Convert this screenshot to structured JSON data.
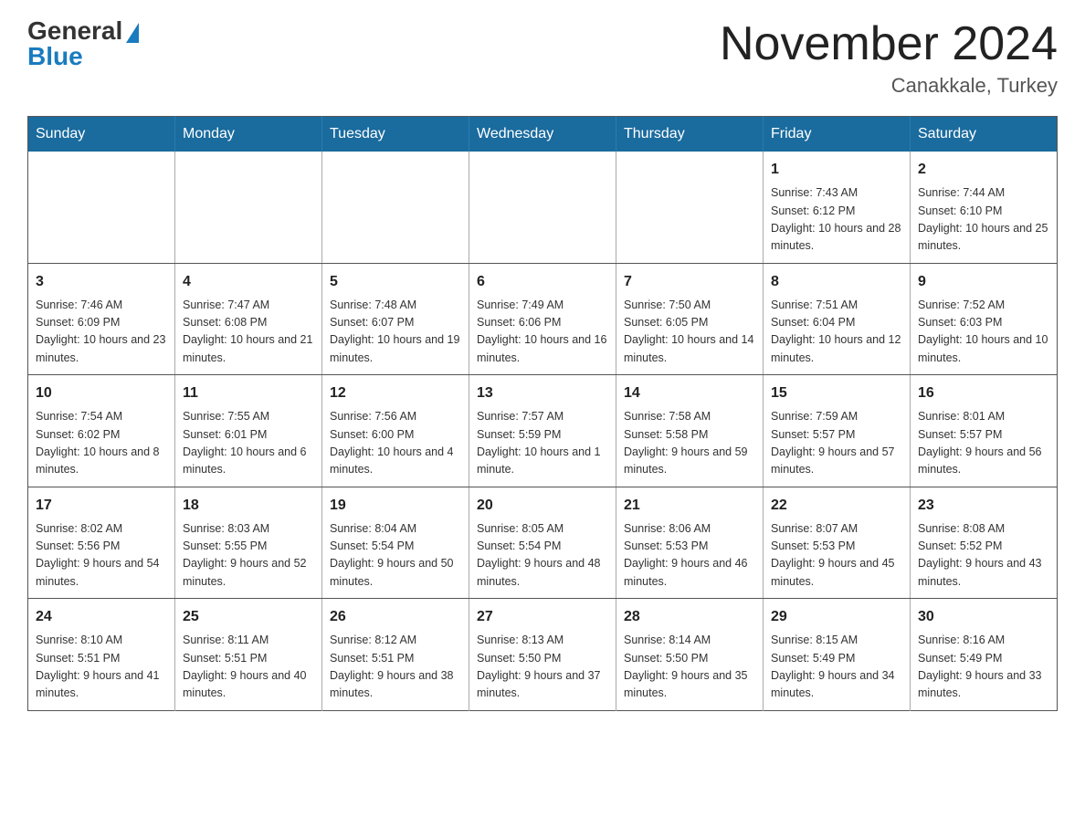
{
  "header": {
    "logo_general": "General",
    "logo_blue": "Blue",
    "title": "November 2024",
    "subtitle": "Canakkale, Turkey"
  },
  "weekdays": [
    "Sunday",
    "Monday",
    "Tuesday",
    "Wednesday",
    "Thursday",
    "Friday",
    "Saturday"
  ],
  "weeks": [
    [
      {
        "day": "",
        "info": ""
      },
      {
        "day": "",
        "info": ""
      },
      {
        "day": "",
        "info": ""
      },
      {
        "day": "",
        "info": ""
      },
      {
        "day": "",
        "info": ""
      },
      {
        "day": "1",
        "info": "Sunrise: 7:43 AM\nSunset: 6:12 PM\nDaylight: 10 hours and 28 minutes."
      },
      {
        "day": "2",
        "info": "Sunrise: 7:44 AM\nSunset: 6:10 PM\nDaylight: 10 hours and 25 minutes."
      }
    ],
    [
      {
        "day": "3",
        "info": "Sunrise: 7:46 AM\nSunset: 6:09 PM\nDaylight: 10 hours and 23 minutes."
      },
      {
        "day": "4",
        "info": "Sunrise: 7:47 AM\nSunset: 6:08 PM\nDaylight: 10 hours and 21 minutes."
      },
      {
        "day": "5",
        "info": "Sunrise: 7:48 AM\nSunset: 6:07 PM\nDaylight: 10 hours and 19 minutes."
      },
      {
        "day": "6",
        "info": "Sunrise: 7:49 AM\nSunset: 6:06 PM\nDaylight: 10 hours and 16 minutes."
      },
      {
        "day": "7",
        "info": "Sunrise: 7:50 AM\nSunset: 6:05 PM\nDaylight: 10 hours and 14 minutes."
      },
      {
        "day": "8",
        "info": "Sunrise: 7:51 AM\nSunset: 6:04 PM\nDaylight: 10 hours and 12 minutes."
      },
      {
        "day": "9",
        "info": "Sunrise: 7:52 AM\nSunset: 6:03 PM\nDaylight: 10 hours and 10 minutes."
      }
    ],
    [
      {
        "day": "10",
        "info": "Sunrise: 7:54 AM\nSunset: 6:02 PM\nDaylight: 10 hours and 8 minutes."
      },
      {
        "day": "11",
        "info": "Sunrise: 7:55 AM\nSunset: 6:01 PM\nDaylight: 10 hours and 6 minutes."
      },
      {
        "day": "12",
        "info": "Sunrise: 7:56 AM\nSunset: 6:00 PM\nDaylight: 10 hours and 4 minutes."
      },
      {
        "day": "13",
        "info": "Sunrise: 7:57 AM\nSunset: 5:59 PM\nDaylight: 10 hours and 1 minute."
      },
      {
        "day": "14",
        "info": "Sunrise: 7:58 AM\nSunset: 5:58 PM\nDaylight: 9 hours and 59 minutes."
      },
      {
        "day": "15",
        "info": "Sunrise: 7:59 AM\nSunset: 5:57 PM\nDaylight: 9 hours and 57 minutes."
      },
      {
        "day": "16",
        "info": "Sunrise: 8:01 AM\nSunset: 5:57 PM\nDaylight: 9 hours and 56 minutes."
      }
    ],
    [
      {
        "day": "17",
        "info": "Sunrise: 8:02 AM\nSunset: 5:56 PM\nDaylight: 9 hours and 54 minutes."
      },
      {
        "day": "18",
        "info": "Sunrise: 8:03 AM\nSunset: 5:55 PM\nDaylight: 9 hours and 52 minutes."
      },
      {
        "day": "19",
        "info": "Sunrise: 8:04 AM\nSunset: 5:54 PM\nDaylight: 9 hours and 50 minutes."
      },
      {
        "day": "20",
        "info": "Sunrise: 8:05 AM\nSunset: 5:54 PM\nDaylight: 9 hours and 48 minutes."
      },
      {
        "day": "21",
        "info": "Sunrise: 8:06 AM\nSunset: 5:53 PM\nDaylight: 9 hours and 46 minutes."
      },
      {
        "day": "22",
        "info": "Sunrise: 8:07 AM\nSunset: 5:53 PM\nDaylight: 9 hours and 45 minutes."
      },
      {
        "day": "23",
        "info": "Sunrise: 8:08 AM\nSunset: 5:52 PM\nDaylight: 9 hours and 43 minutes."
      }
    ],
    [
      {
        "day": "24",
        "info": "Sunrise: 8:10 AM\nSunset: 5:51 PM\nDaylight: 9 hours and 41 minutes."
      },
      {
        "day": "25",
        "info": "Sunrise: 8:11 AM\nSunset: 5:51 PM\nDaylight: 9 hours and 40 minutes."
      },
      {
        "day": "26",
        "info": "Sunrise: 8:12 AM\nSunset: 5:51 PM\nDaylight: 9 hours and 38 minutes."
      },
      {
        "day": "27",
        "info": "Sunrise: 8:13 AM\nSunset: 5:50 PM\nDaylight: 9 hours and 37 minutes."
      },
      {
        "day": "28",
        "info": "Sunrise: 8:14 AM\nSunset: 5:50 PM\nDaylight: 9 hours and 35 minutes."
      },
      {
        "day": "29",
        "info": "Sunrise: 8:15 AM\nSunset: 5:49 PM\nDaylight: 9 hours and 34 minutes."
      },
      {
        "day": "30",
        "info": "Sunrise: 8:16 AM\nSunset: 5:49 PM\nDaylight: 9 hours and 33 minutes."
      }
    ]
  ]
}
